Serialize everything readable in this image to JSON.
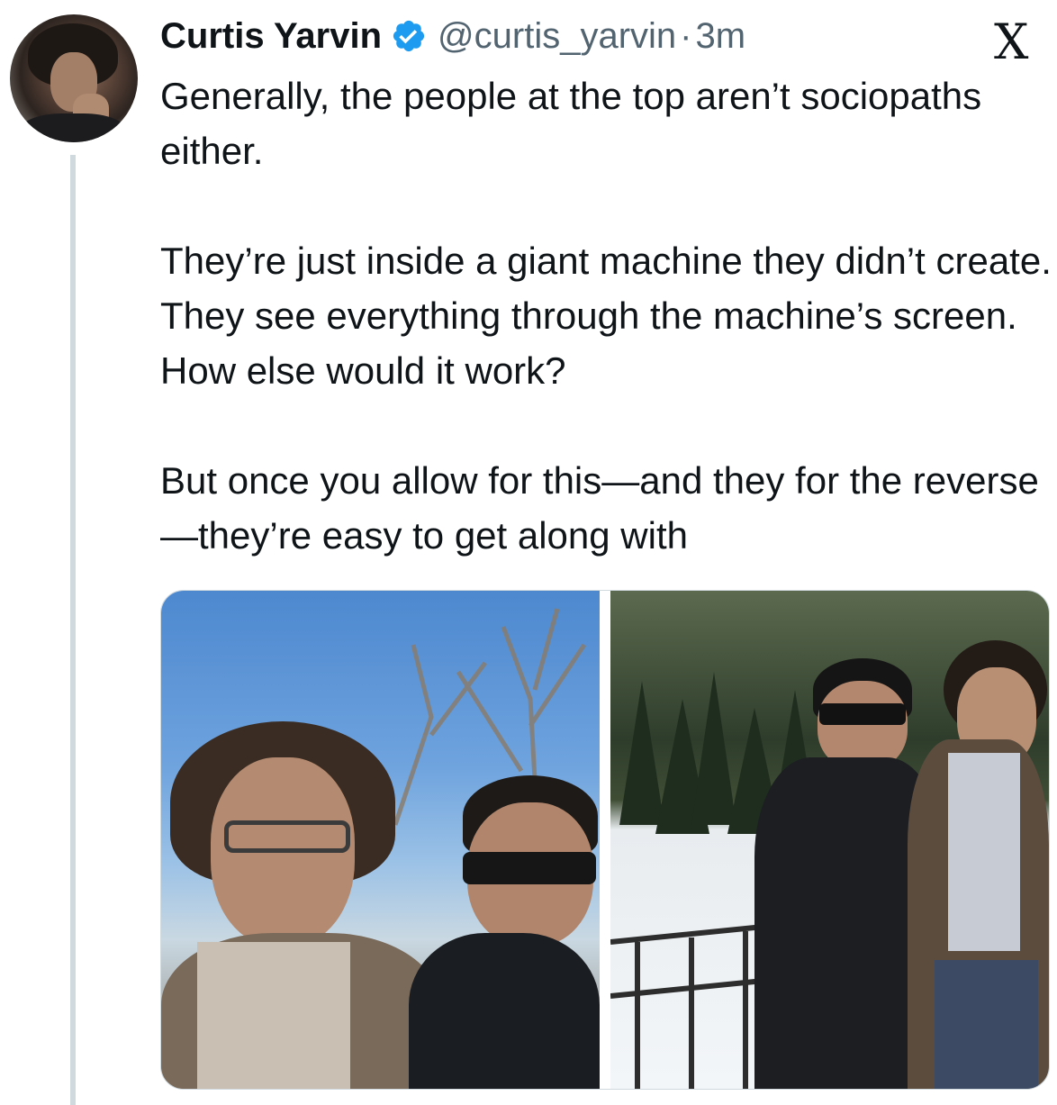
{
  "post": {
    "author_name": "Curtis Yarvin",
    "handle": "@curtis_yarvin",
    "separator": "·",
    "time": "3m",
    "brand_logo": "X",
    "paragraphs": [
      "Generally, the people at the top aren’t sociopaths either.",
      "They’re just inside a giant machine they didn’t create. They see everything through the machine’s screen. How else would it work?",
      "But once you allow for this—and they for the reverse—they’re easy to get along with"
    ],
    "verified_badge_color": "#1d9bf0"
  },
  "icons": {
    "verified": "verified-badge-icon",
    "brand": "x-logo-icon"
  }
}
